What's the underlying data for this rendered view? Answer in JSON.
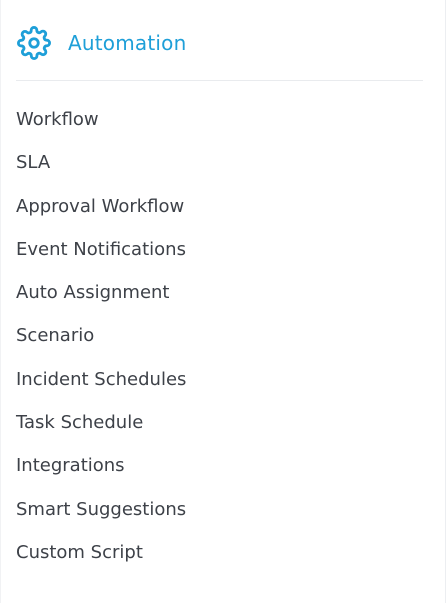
{
  "header": {
    "icon": "gear-icon",
    "title": "Automation",
    "accent_color": "#1E9FD8"
  },
  "menu": {
    "items": [
      {
        "label": "Workflow"
      },
      {
        "label": "SLA"
      },
      {
        "label": "Approval Workflow"
      },
      {
        "label": "Event Notifications"
      },
      {
        "label": "Auto Assignment"
      },
      {
        "label": "Scenario"
      },
      {
        "label": "Incident Schedules"
      },
      {
        "label": "Task Schedule"
      },
      {
        "label": "Integrations"
      },
      {
        "label": "Smart Suggestions"
      },
      {
        "label": "Custom Script"
      }
    ]
  }
}
